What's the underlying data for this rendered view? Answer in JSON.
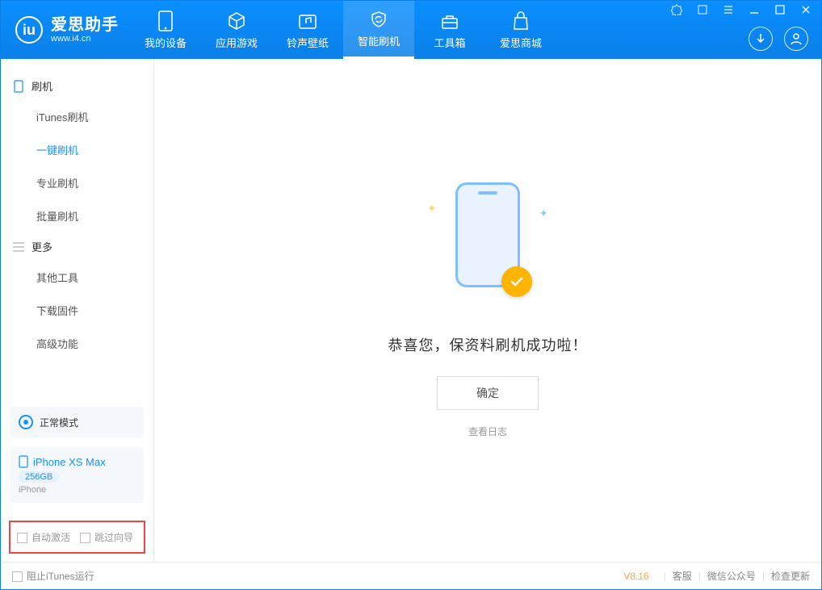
{
  "app": {
    "name": "爱思助手",
    "domain": "www.i4.cn"
  },
  "nav": {
    "items": [
      {
        "label": "我的设备"
      },
      {
        "label": "应用游戏"
      },
      {
        "label": "铃声壁纸"
      },
      {
        "label": "智能刷机"
      },
      {
        "label": "工具箱"
      },
      {
        "label": "爱思商城"
      }
    ],
    "active_index": 3
  },
  "sidebar": {
    "groups": [
      {
        "title": "刷机",
        "items": [
          {
            "label": "iTunes刷机"
          },
          {
            "label": "一键刷机",
            "active": true
          },
          {
            "label": "专业刷机"
          },
          {
            "label": "批量刷机"
          }
        ]
      },
      {
        "title": "更多",
        "items": [
          {
            "label": "其他工具"
          },
          {
            "label": "下载固件"
          },
          {
            "label": "高级功能"
          }
        ]
      }
    ],
    "mode": {
      "label": "正常模式"
    },
    "device": {
      "name": "iPhone XS Max",
      "storage": "256GB",
      "type": "iPhone"
    },
    "options": {
      "auto_activate": "自动激活",
      "skip_guide": "跳过向导"
    }
  },
  "main": {
    "success_text": "恭喜您，保资料刷机成功啦！",
    "ok_button": "确定",
    "view_log": "查看日志"
  },
  "status": {
    "block_itunes": "阻止iTunes运行",
    "version": "V8.16",
    "links": [
      "客服",
      "微信公众号",
      "检查更新"
    ]
  }
}
